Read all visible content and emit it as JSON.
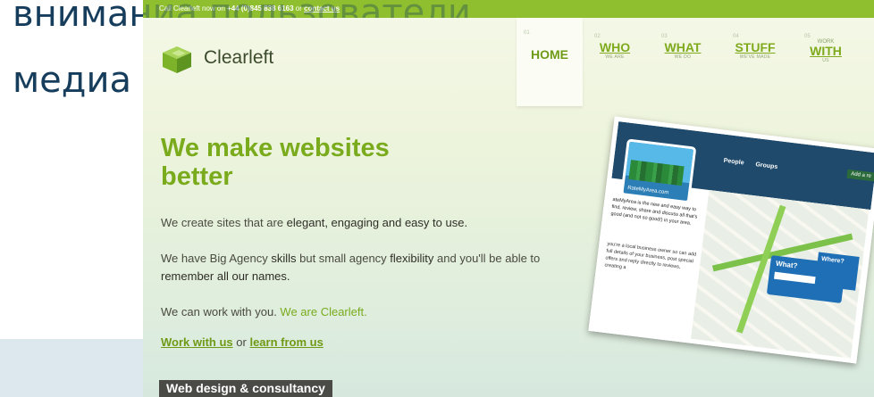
{
  "slide": {
    "line1": "вниманиа пользователи",
    "line2": "медиа"
  },
  "topbar": {
    "prefix": "Call Clearleft now on ",
    "phone": "+44 (0)845 838 6163",
    "middle": " or ",
    "contact": "contact us"
  },
  "logo": {
    "name": "Clearleft"
  },
  "nav": [
    {
      "num": "01",
      "label": "HOME",
      "sub": ""
    },
    {
      "num": "02",
      "label": "WHO",
      "sub": "WE ARE"
    },
    {
      "num": "03",
      "label": "WHAT",
      "sub": "WE DO"
    },
    {
      "num": "04",
      "label": "STUFF",
      "sub": "WE'VE MADE"
    },
    {
      "num": "05",
      "pre": "WORK",
      "label": "WITH",
      "sub": "US"
    }
  ],
  "hero": {
    "headline": "We make websites better",
    "p1_a": "We create sites that are ",
    "p1_b": "elegant, engaging and easy to use.",
    "p2_a": "We have Big Agency ",
    "p2_b": "skills",
    "p2_c": " but small agency ",
    "p2_d": "flexibility",
    "p2_e": " and you'll be able to ",
    "p2_f": "remember all our names.",
    "p3_a": "We can work with you. ",
    "p3_b": "We are Clearleft.",
    "link1": "Work with us",
    "or": " or ",
    "link2": "learn from us",
    "badge": "Web design & consultancy"
  },
  "mock": {
    "nav1": "People",
    "nav2": "Groups",
    "add": "Add a re",
    "logo_text": "RateMyArea.com",
    "copy": "ateMyArea is the new and easy way to find, review, share and discuss all that's good (and not so good!) in your area.",
    "copy2": "you're a local business owner so can add full details of your business, post special offers and reply directly to reviews, creating a",
    "what": "What?",
    "where": "Where?"
  }
}
